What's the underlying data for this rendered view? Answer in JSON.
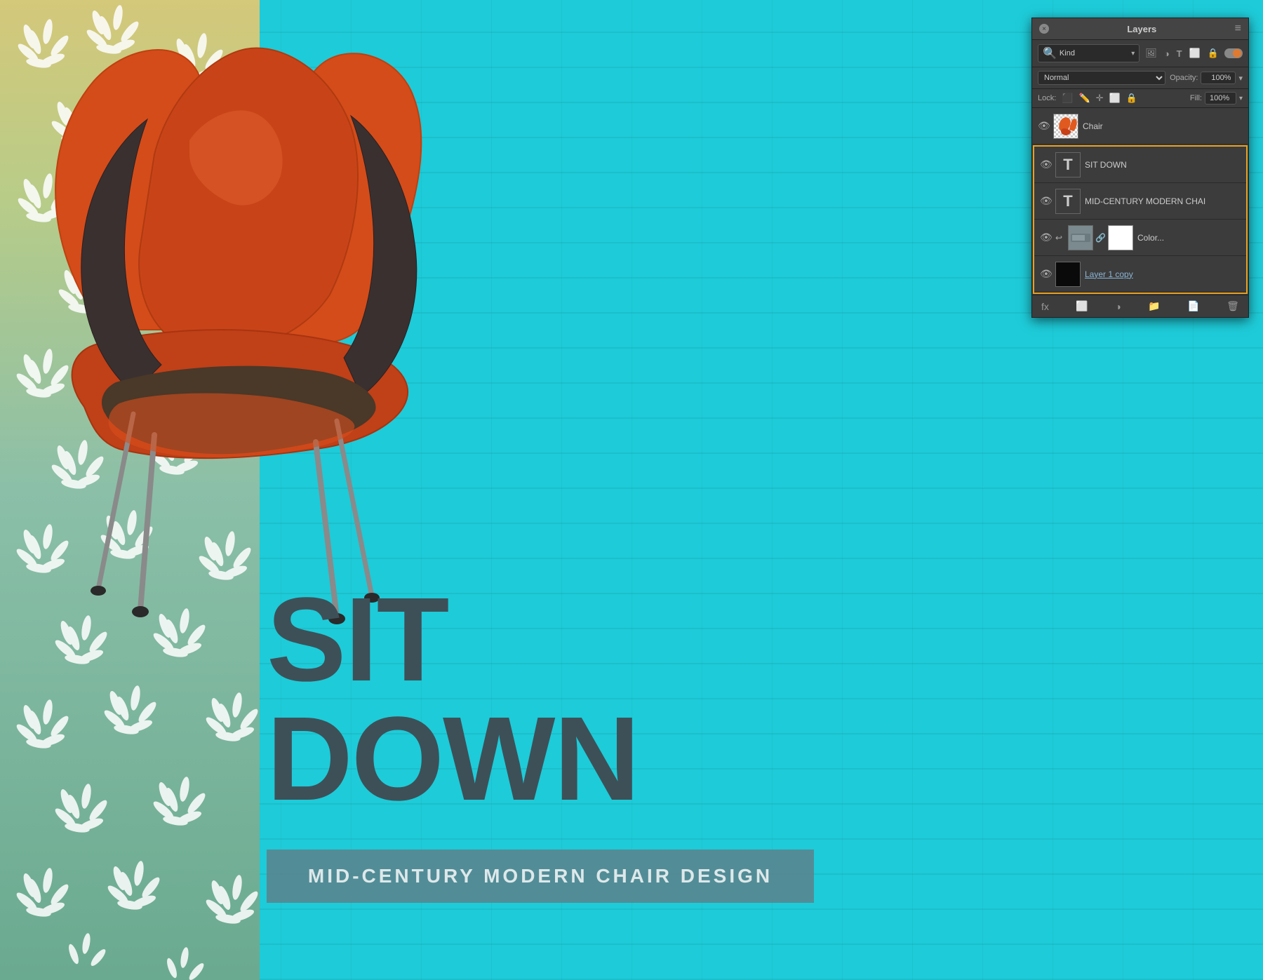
{
  "canvas": {
    "title": "SIT DOWN",
    "subtitle": "MID-CENTURY MODERN CHAIR DESIGN"
  },
  "panel": {
    "title": "Layers",
    "close_btn": "×",
    "menu_icon": "≡",
    "search": {
      "placeholder": "Kind",
      "label": "Kind"
    },
    "blend_mode": "Normal",
    "opacity_label": "Opacity:",
    "opacity_value": "100%",
    "lock_label": "Lock:",
    "fill_label": "Fill:",
    "fill_value": "100%",
    "layers": [
      {
        "id": "chair",
        "name": "Chair",
        "type": "image",
        "visible": true,
        "thumbnail": "chair"
      },
      {
        "id": "sit-down",
        "name": "SIT DOWN",
        "type": "text",
        "visible": true,
        "selected_group": true
      },
      {
        "id": "mid-century",
        "name": "MID-CENTURY MODERN CHAI",
        "type": "text",
        "visible": true,
        "selected_group": true
      },
      {
        "id": "color-effect",
        "name": "Color...",
        "type": "adjustment",
        "visible": true,
        "selected_group": true
      },
      {
        "id": "layer1copy",
        "name": "Layer 1 copy",
        "type": "normal",
        "visible": true,
        "selected_group": true
      }
    ],
    "bottom_buttons": [
      "fx-btn",
      "mask-btn",
      "adj-btn",
      "group-btn",
      "new-btn",
      "delete-btn"
    ]
  }
}
